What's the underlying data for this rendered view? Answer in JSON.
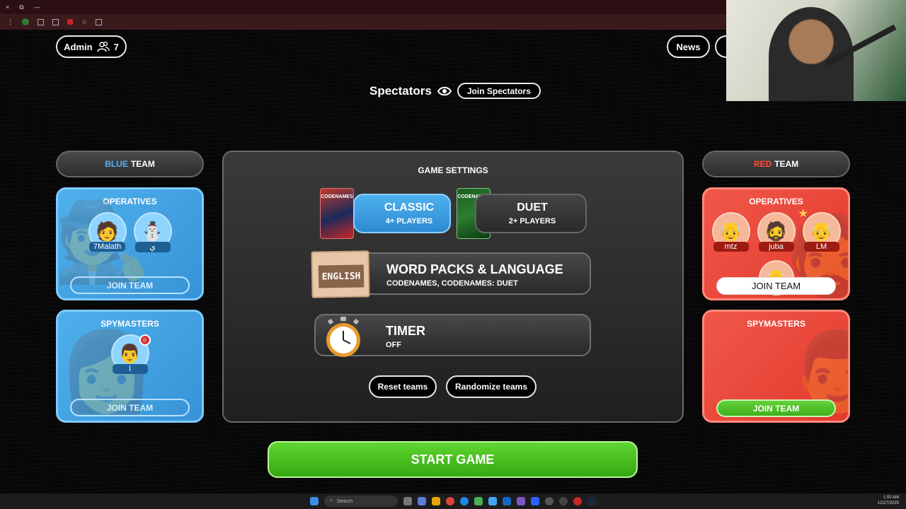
{
  "browser": {
    "close_glyph": "×",
    "restore_glyph": "⧉",
    "minimize_glyph": "—"
  },
  "header": {
    "admin_label": "Admin",
    "player_count": "7",
    "news_label": "News"
  },
  "spectators": {
    "title": "Spectators",
    "join_label": "Join Spectators"
  },
  "blue_team": {
    "header_color_word": "BLUE",
    "header_word": "TEAM",
    "operatives_title": "OPERATIVES",
    "operatives": [
      {
        "name": "7Malath",
        "face": "🧑"
      },
      {
        "name": "ي",
        "face": "⛄"
      }
    ],
    "operatives_join": "JOIN TEAM",
    "spymasters_title": "SPYMASTERS",
    "spymasters": [
      {
        "name": "l",
        "face": "👨"
      }
    ],
    "spymasters_join": "JOIN TEAM"
  },
  "red_team": {
    "header_color_word": "RED",
    "header_word": "TEAM",
    "operatives_title": "OPERATIVES",
    "operatives": [
      {
        "name": "mtz",
        "face": "👴"
      },
      {
        "name": "juba",
        "face": "🧔"
      },
      {
        "name": "LM",
        "face": "👴"
      }
    ],
    "operatives_join": "JOIN TEAM",
    "spymasters_title": "SPYMASTERS",
    "spymasters_join": "JOIN TEAM"
  },
  "settings": {
    "title": "GAME SETTINGS",
    "classic": {
      "label": "CLASSIC",
      "sub": "4+ PLAYERS",
      "art_text": "CODENAMES"
    },
    "duet": {
      "label": "DUET",
      "sub": "2+ PLAYERS",
      "art_text": "CODENAMES"
    },
    "packs": {
      "label": "WORD PACKS & LANGUAGE",
      "sub": "CODENAMES, CODENAMES: DUET",
      "card_text": "ENGLISH"
    },
    "timer": {
      "label": "TIMER",
      "sub": "OFF"
    },
    "reset_label": "Reset teams",
    "randomize_label": "Randomize teams"
  },
  "start_label": "START GAME",
  "taskbar": {
    "search_label": "Search",
    "time": "1:00 AM",
    "date": "12/27/2025"
  },
  "colors": {
    "blue_accent": "#4fb3ff",
    "red_accent": "#ff4d3d",
    "start_green": "#4cc322"
  }
}
